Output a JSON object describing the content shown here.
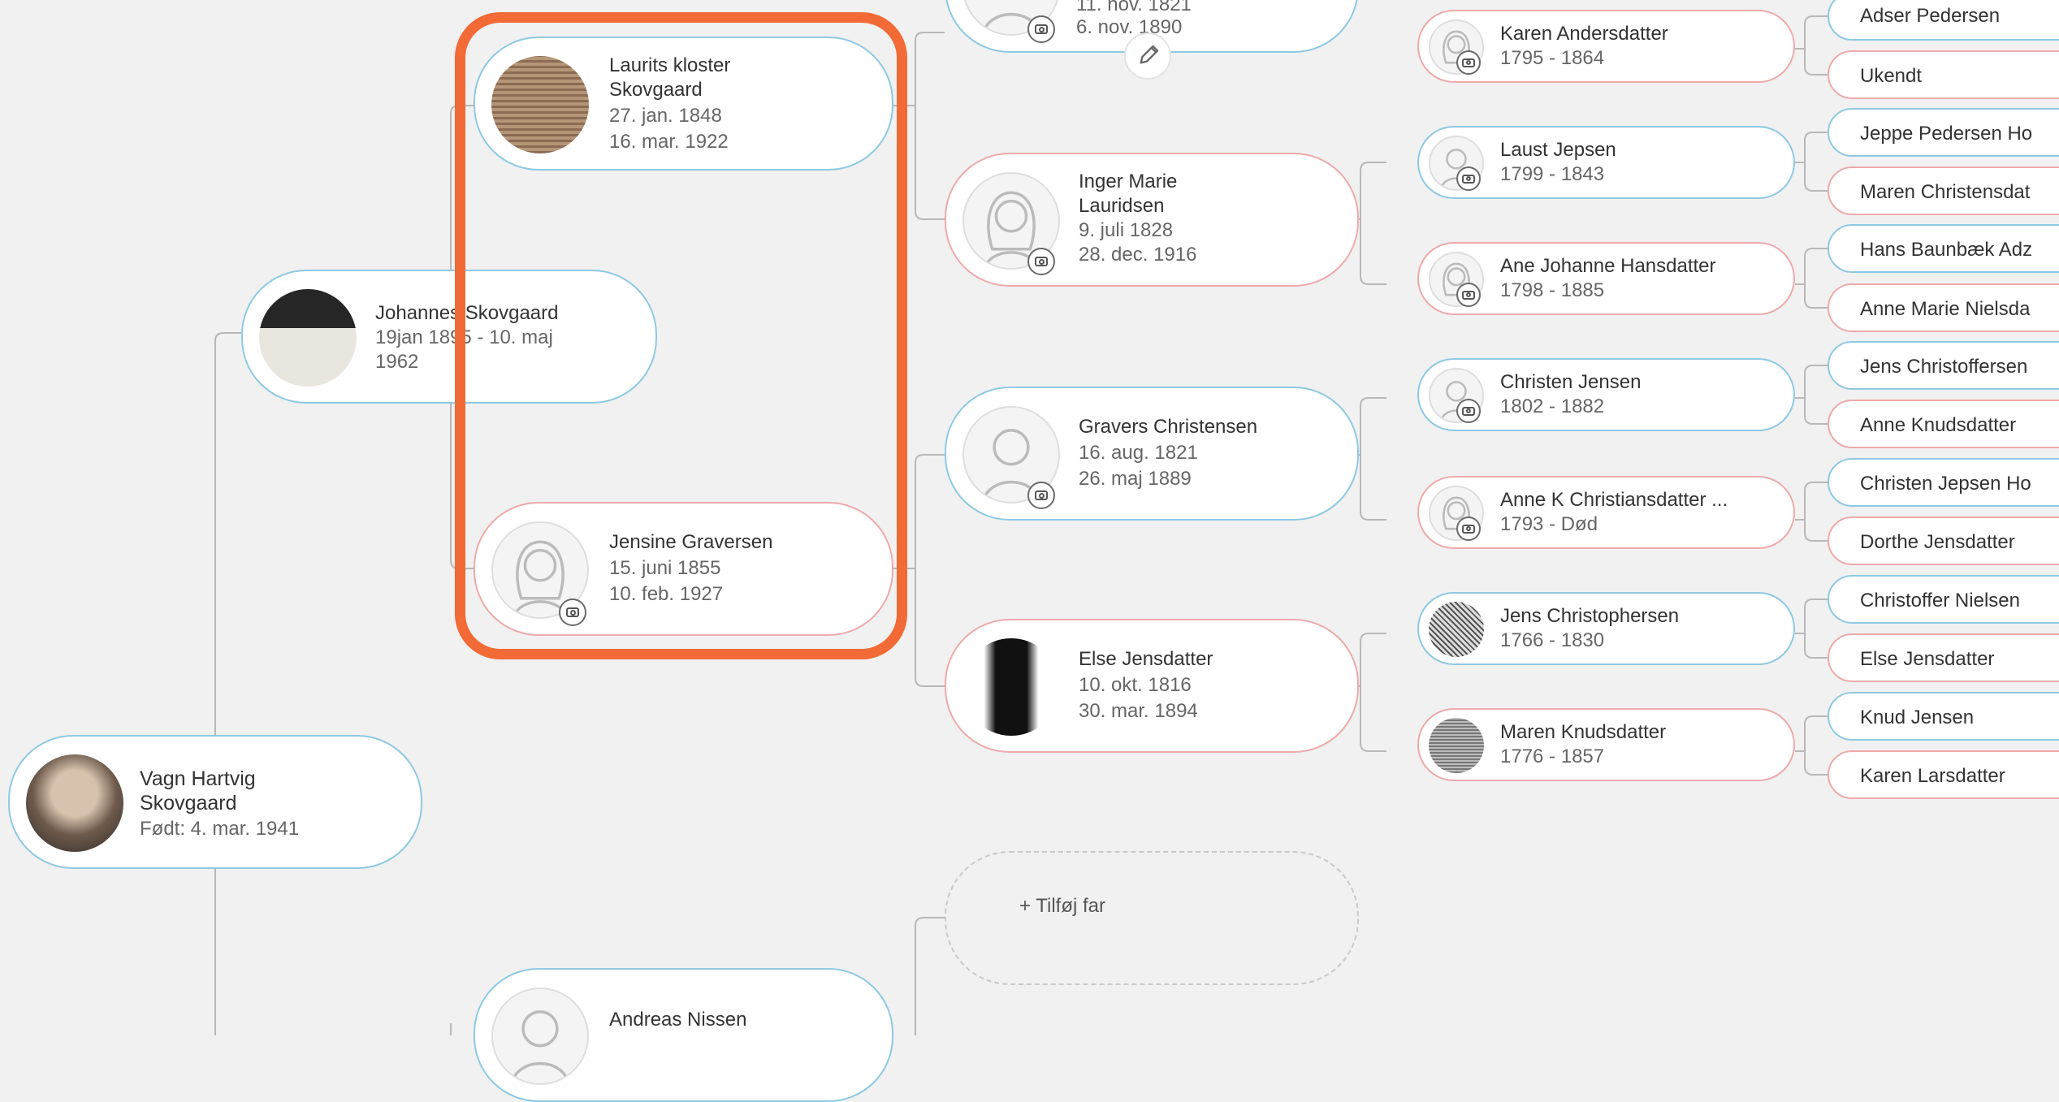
{
  "persons": {
    "vagn": {
      "name": "Vagn Hartvig",
      "name2": "Skovgaard",
      "born": "Født: 4. mar. 1941"
    },
    "johannes": {
      "name": "Johannes Skovgaard",
      "line1": "19jan 1895 - 10. maj",
      "line2": "1962"
    },
    "laurits": {
      "name": "Laurits kloster",
      "name2": "Skovgaard",
      "born": "27. jan. 1848",
      "died": "16. mar. 1922"
    },
    "jensine": {
      "name": "Jensine Graversen",
      "born": "15. juni 1855",
      "died": "10. feb. 1927"
    },
    "andreas": {
      "name": "Andreas Nissen"
    },
    "top_partial": {
      "born": "11. nov. 1821",
      "died": "6. nov. 1890"
    },
    "inger": {
      "name": "Inger Marie",
      "name2": "Lauridsen",
      "born": "9. juli 1828",
      "died": "28. dec. 1916"
    },
    "gravers": {
      "name": "Gravers Christensen",
      "born": "16. aug. 1821",
      "died": "26. maj 1889"
    },
    "else": {
      "name": "Else Jensdatter",
      "born": "10. okt. 1816",
      "died": "30. mar. 1894"
    },
    "karen": {
      "name": "Karen Andersdatter",
      "years": "1795 - 1864"
    },
    "laust": {
      "name": "Laust Jepsen",
      "years": "1799 - 1843"
    },
    "ane_johanne": {
      "name": "Ane Johanne Hansdatter",
      "years": "1798 - 1885"
    },
    "christen": {
      "name": "Christen Jensen",
      "years": "1802 - 1882"
    },
    "anne_k": {
      "name": "Anne K Christiansdatter ...",
      "years": "1793 - Død"
    },
    "jens_c": {
      "name": "Jens Christophersen",
      "years": "1766 - 1830"
    },
    "maren": {
      "name": "Maren Knudsdatter",
      "years": "1776 - 1857"
    }
  },
  "chips": [
    "Adser Pedersen",
    "Ukendt",
    "Jeppe Pedersen Ho",
    "Maren Christensdat",
    "Hans Baunbæk Adz",
    "Anne Marie Nielsda",
    "Jens Christoffersen",
    "Anne Knudsdatter",
    "Christen Jepsen Ho",
    "Dorthe Jensdatter",
    "Christoffer Nielsen",
    "Else Jensdatter",
    "Knud Jensen",
    "Karen Larsdatter"
  ],
  "add_father": {
    "plus": "+",
    "label": "Tilføj far"
  },
  "colors": {
    "male_border": "#8ec9e3",
    "female_border": "#eeaaaa",
    "highlight": "#f26a36",
    "line": "#b8b8b8"
  },
  "icons": [
    "camera-icon",
    "pencil-icon",
    "plus-icon",
    "avatar-male-icon",
    "avatar-female-icon"
  ]
}
